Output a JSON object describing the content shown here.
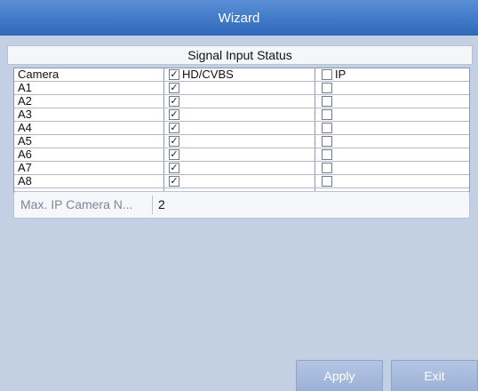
{
  "window": {
    "title": "Wizard"
  },
  "section": {
    "title": "Signal Input Status"
  },
  "table": {
    "header": {
      "camera": "Camera",
      "hd": "HD/CVBS",
      "ip": "IP",
      "hd_checked": true,
      "ip_checked": false
    },
    "rows": [
      {
        "name": "A1",
        "hd_checked": true,
        "ip_checked": false
      },
      {
        "name": "A2",
        "hd_checked": true,
        "ip_checked": false
      },
      {
        "name": "A3",
        "hd_checked": true,
        "ip_checked": false
      },
      {
        "name": "A4",
        "hd_checked": true,
        "ip_checked": false
      },
      {
        "name": "A5",
        "hd_checked": true,
        "ip_checked": false
      },
      {
        "name": "A6",
        "hd_checked": true,
        "ip_checked": false
      },
      {
        "name": "A7",
        "hd_checked": true,
        "ip_checked": false
      },
      {
        "name": "A8",
        "hd_checked": true,
        "ip_checked": false
      }
    ]
  },
  "max_ip": {
    "label": "Max. IP Camera N...",
    "value": "2"
  },
  "buttons": {
    "apply": "Apply",
    "exit": "Exit"
  }
}
